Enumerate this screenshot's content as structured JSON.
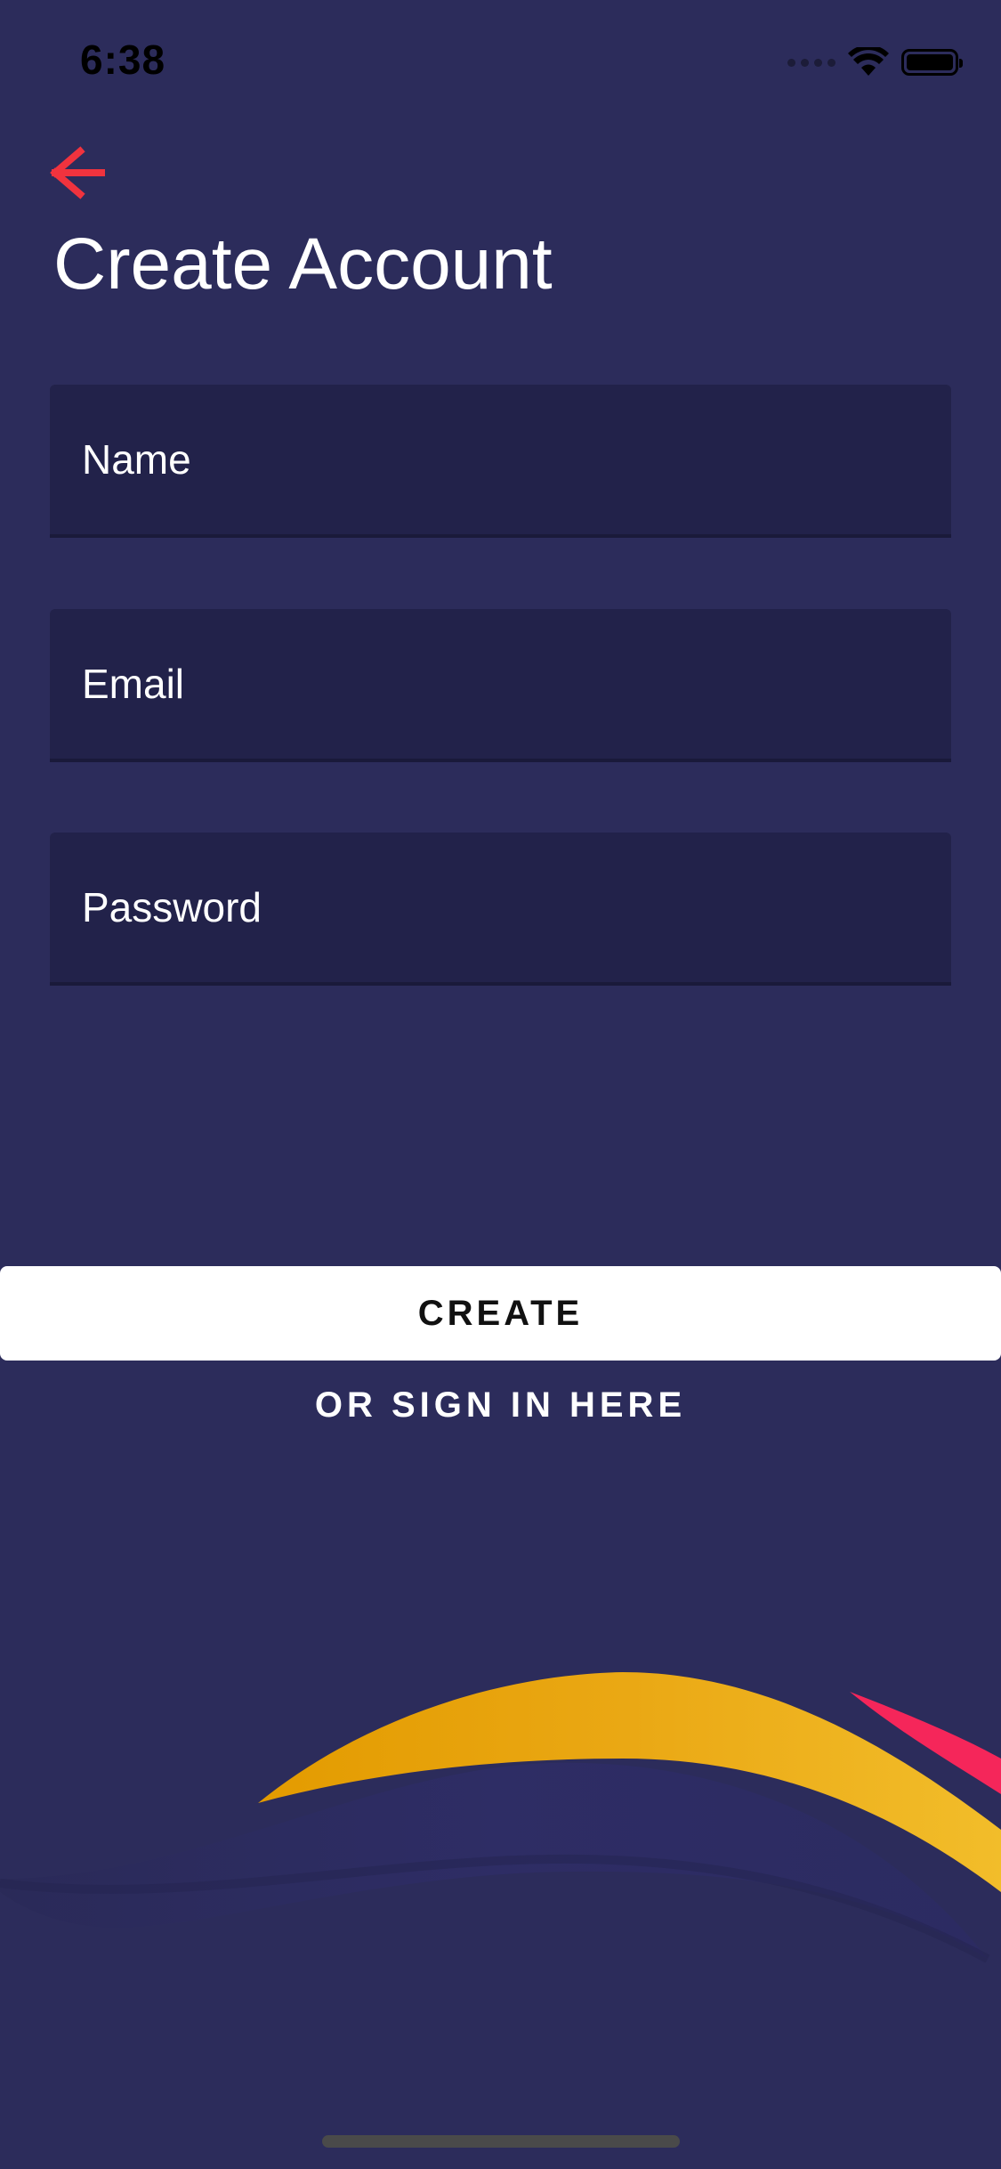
{
  "status_bar": {
    "time": "6:38",
    "icons": [
      "cellular-signal-icon",
      "wifi-icon",
      "battery-icon"
    ]
  },
  "header": {
    "back_icon": "arrow-left-icon",
    "title": "Create Account"
  },
  "form": {
    "name_placeholder": "Name",
    "email_placeholder": "Email",
    "password_placeholder": "Password"
  },
  "actions": {
    "create_label": "CREATE",
    "signin_label": "OR SIGN IN HERE"
  },
  "colors": {
    "background": "#2c2c5b",
    "field_background": "#22224a",
    "accent": "#f0333e",
    "wave_yellow": "#f2b01e",
    "wave_pink": "#f5265a"
  }
}
